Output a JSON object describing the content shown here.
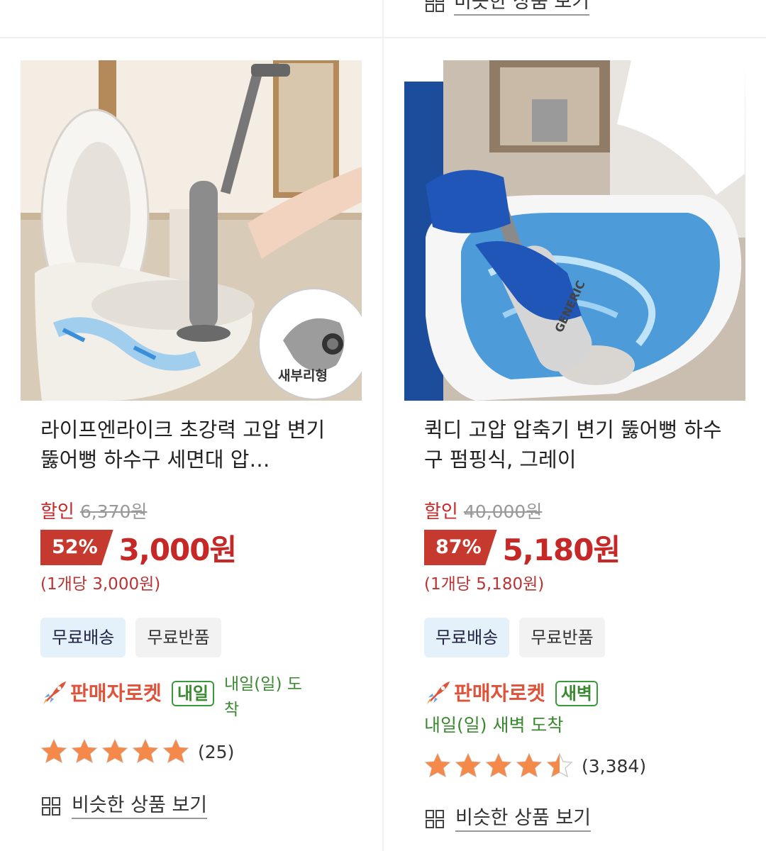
{
  "top_row": {
    "similar_label": "비슷한 상품 보기"
  },
  "products": [
    {
      "title": "라이프엔라이크 초강력 고압 변기 뚫어뻥 하수구 세면대 압…",
      "discount_label": "할인",
      "original_price": "6,370원",
      "discount_percent": "52%",
      "sale_price": "3,000원",
      "unit_price": "(1개당 3,000원)",
      "tags": [
        "무료배송",
        "무료반품"
      ],
      "rocket_brand": "판매자로켓",
      "rocket_badge": "내일",
      "arrival": "내일(일) 도착",
      "rating": 5.0,
      "review_count": "(25)",
      "image_badge": "새부리형",
      "similar_label": "비슷한 상품 보기"
    },
    {
      "title": "퀵디 고압 압축기 변기 뚫어뻥 하수구 펌핑식, 그레이",
      "discount_label": "할인",
      "original_price": "40,000원",
      "discount_percent": "87%",
      "sale_price": "5,180원",
      "unit_price": "(1개당 5,180원)",
      "tags": [
        "무료배송",
        "무료반품"
      ],
      "rocket_brand": "판매자로켓",
      "rocket_badge": "새벽",
      "arrival": "내일(일) 새벽 도착",
      "rating": 4.5,
      "review_count": "(3,384)",
      "image_label": "GENERIC",
      "similar_label": "비슷한 상품 보기"
    }
  ],
  "colors": {
    "price_red": "#c62828",
    "badge_red": "#c6392e",
    "star_orange": "#f5894a",
    "rocket_green": "#3a8a30",
    "tag_blue_bg": "#e4f1fb"
  }
}
